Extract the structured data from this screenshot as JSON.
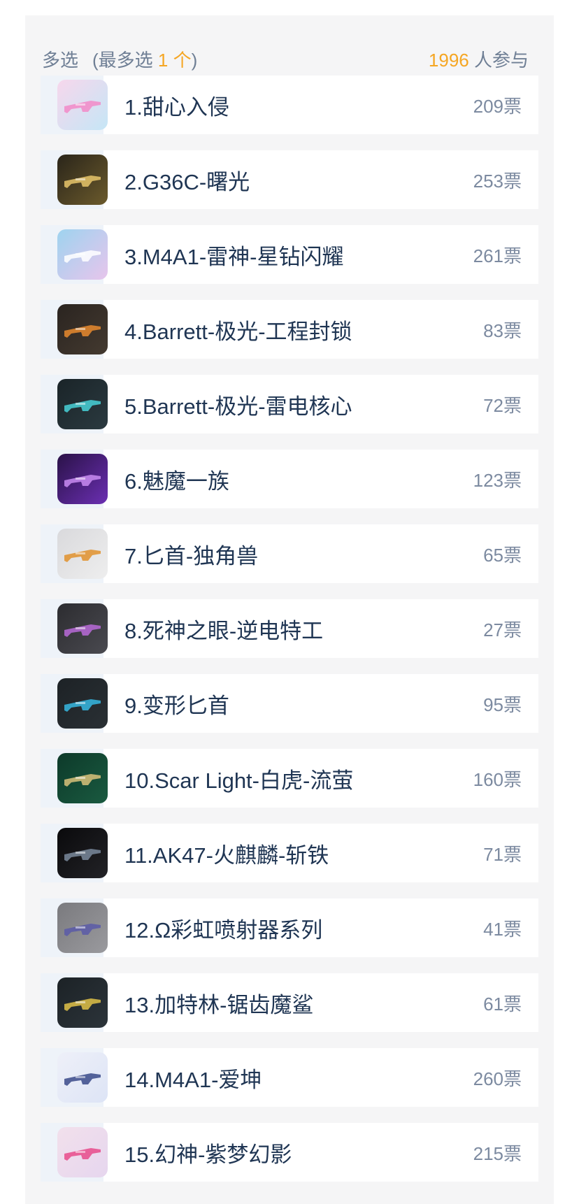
{
  "header": {
    "mode_label": "多选",
    "limit_prefix": "(最多选 ",
    "limit_count": "1 个",
    "limit_suffix": ")",
    "participants_count": "1996",
    "participants_suffix": " 人参与"
  },
  "colors": {
    "accent": "#f5a623",
    "text_primary": "#1f3553",
    "text_secondary": "#7c8aa0",
    "panel_bg": "#f5f5f6",
    "progress_bar": "#eef3f9"
  },
  "options": [
    {
      "label": "1.甜心入侵",
      "votes": "209票",
      "icon": "sweetheart-gun-thumbnail",
      "bg1": "#f7d7ec",
      "bg2": "#c5e6f6",
      "fg": "#f28ac8"
    },
    {
      "label": "2.G36C-曙光",
      "votes": "253票",
      "icon": "g36c-dawn-thumbnail",
      "bg1": "#2a251a",
      "bg2": "#6b5a2c",
      "fg": "#e7c66a"
    },
    {
      "label": "3.M4A1-雷神-星钻闪耀",
      "votes": "261票",
      "icon": "m4a1-thor-thumbnail",
      "bg1": "#9ed3ef",
      "bg2": "#e7c5ec",
      "fg": "#ffffff"
    },
    {
      "label": "4.Barrett-极光-工程封锁",
      "votes": "83票",
      "icon": "barrett-aurora-engineering-thumbnail",
      "bg1": "#2a2420",
      "bg2": "#443a30",
      "fg": "#e88a2e"
    },
    {
      "label": "5.Barrett-极光-雷电核心",
      "votes": "72票",
      "icon": "barrett-aurora-thunder-thumbnail",
      "bg1": "#1a2428",
      "bg2": "#2b3a40",
      "fg": "#48d2d8"
    },
    {
      "label": "6.魅魔一族",
      "votes": "123票",
      "icon": "succubus-thumbnail",
      "bg1": "#2a1248",
      "bg2": "#6b2fb2",
      "fg": "#c98cf2"
    },
    {
      "label": "7.匕首-独角兽",
      "votes": "65票",
      "icon": "dagger-unicorn-thumbnail",
      "bg1": "#d9d9dc",
      "bg2": "#eeeeee",
      "fg": "#e0902b"
    },
    {
      "label": "8.死神之眼-逆电特工",
      "votes": "27票",
      "icon": "reaper-eye-thumbnail",
      "bg1": "#2c2c30",
      "bg2": "#4a4a50",
      "fg": "#b86ad8"
    },
    {
      "label": "9.变形匕首",
      "votes": "95票",
      "icon": "transform-dagger-thumbnail",
      "bg1": "#1d2226",
      "bg2": "#2a3034",
      "fg": "#36b9e2"
    },
    {
      "label": "10.Scar Light-白虎-流萤",
      "votes": "160票",
      "icon": "scar-light-tiger-thumbnail",
      "bg1": "#0d3a2a",
      "bg2": "#1a5a40",
      "fg": "#d9c27a"
    },
    {
      "label": "11.AK47-火麒麟-斩铁",
      "votes": "71票",
      "icon": "ak47-fire-kirin-thumbnail",
      "bg1": "#0a0a0c",
      "bg2": "#222226",
      "fg": "#7a8a9c"
    },
    {
      "label": "12.Ω彩虹喷射器系列",
      "votes": "41票",
      "icon": "rainbow-jet-thumbnail",
      "bg1": "#7a7a7e",
      "bg2": "#9a9a9e",
      "fg": "#5a5aa8"
    },
    {
      "label": "13.加特林-锯齿魔鲨",
      "votes": "61票",
      "icon": "gatling-shark-thumbnail",
      "bg1": "#1c2226",
      "bg2": "#2c343a",
      "fg": "#e0c248"
    },
    {
      "label": "14.M4A1-爱坤",
      "votes": "260票",
      "icon": "m4a1-aikun-thumbnail",
      "bg1": "#eef0f8",
      "bg2": "#dde4f6",
      "fg": "#3a4a8a"
    },
    {
      "label": "15.幻神-紫梦幻影",
      "votes": "215票",
      "icon": "phantom-purple-dream-thumbnail",
      "bg1": "#f2e0ec",
      "bg2": "#e6d6ee",
      "fg": "#e84a8a"
    }
  ]
}
